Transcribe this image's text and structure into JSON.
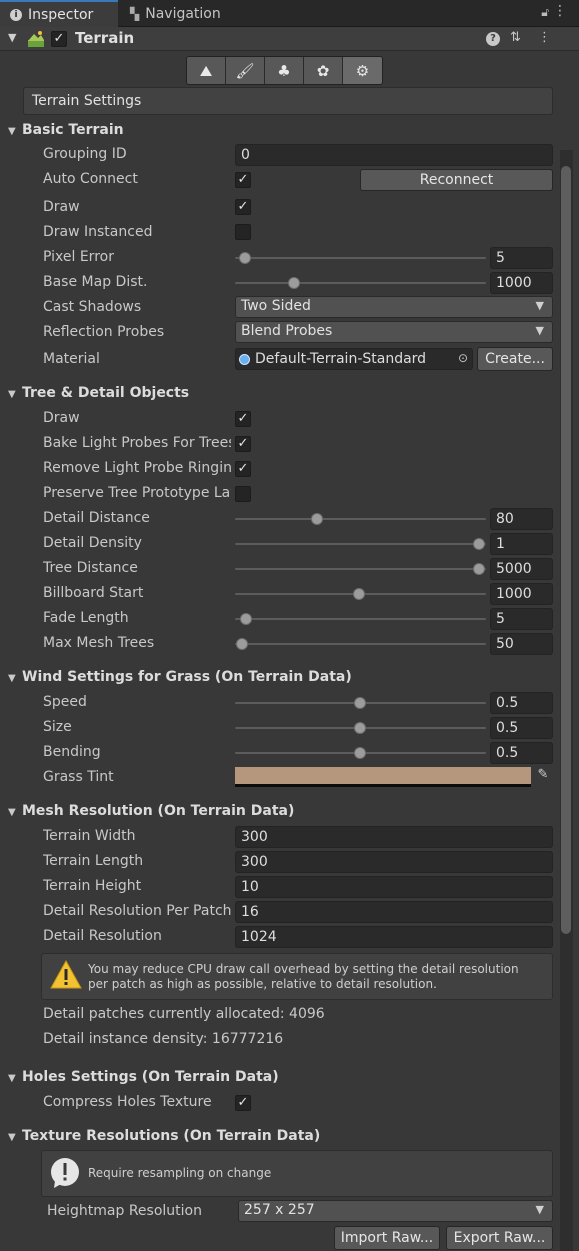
{
  "tabs": {
    "inspector": "Inspector",
    "navigation": "Navigation"
  },
  "component": {
    "name": "Terrain",
    "enabled": true
  },
  "settings_title": "Terrain Settings",
  "basic_terrain": {
    "header": "Basic Terrain",
    "grouping_id_label": "Grouping ID",
    "grouping_id": "0",
    "auto_connect_label": "Auto Connect",
    "auto_connect": true,
    "reconnect_button": "Reconnect",
    "draw_label": "Draw",
    "draw": true,
    "draw_instanced_label": "Draw Instanced",
    "draw_instanced": false,
    "pixel_error_label": "Pixel Error",
    "pixel_error": "5",
    "base_map_dist_label": "Base Map Dist.",
    "base_map_dist": "1000",
    "cast_shadows_label": "Cast Shadows",
    "cast_shadows": "Two Sided",
    "reflection_probes_label": "Reflection Probes",
    "reflection_probes": "Blend Probes",
    "material_label": "Material",
    "material": "Default-Terrain-Standard",
    "create_button": "Create..."
  },
  "tree_detail": {
    "header": "Tree & Detail Objects",
    "draw_label": "Draw",
    "draw": true,
    "bake_label": "Bake Light Probes For Trees",
    "bake": true,
    "remove_label": "Remove Light Probe Ringing",
    "remove": true,
    "preserve_label": "Preserve Tree Prototype Layers",
    "preserve": false,
    "detail_distance_label": "Detail Distance",
    "detail_distance": "80",
    "detail_density_label": "Detail Density",
    "detail_density": "1",
    "tree_distance_label": "Tree Distance",
    "tree_distance": "5000",
    "billboard_start_label": "Billboard Start",
    "billboard_start": "1000",
    "fade_length_label": "Fade Length",
    "fade_length": "5",
    "max_mesh_trees_label": "Max Mesh Trees",
    "max_mesh_trees": "50"
  },
  "wind": {
    "header": "Wind Settings for Grass (On Terrain Data)",
    "speed_label": "Speed",
    "speed": "0.5",
    "size_label": "Size",
    "size": "0.5",
    "bending_label": "Bending",
    "bending": "0.5",
    "grass_tint_label": "Grass Tint",
    "grass_tint_color": "#b5977e"
  },
  "mesh": {
    "header": "Mesh Resolution (On Terrain Data)",
    "width_label": "Terrain Width",
    "width": "300",
    "length_label": "Terrain Length",
    "length": "300",
    "height_label": "Terrain Height",
    "height": "10",
    "detail_per_patch_label": "Detail Resolution Per Patch",
    "detail_per_patch": "16",
    "detail_res_label": "Detail Resolution",
    "detail_res": "1024",
    "warning_line1": "You may reduce CPU draw call overhead by setting the detail resolution",
    "warning_line2": "per patch as high as possible, relative to detail resolution.",
    "patches_allocated": "Detail patches currently allocated: 4096",
    "instance_density": "Detail instance density: 16777216"
  },
  "holes": {
    "header": "Holes Settings (On Terrain Data)",
    "compress_label": "Compress Holes Texture",
    "compress": true
  },
  "texture": {
    "header": "Texture Resolutions (On Terrain Data)",
    "info": "Require resampling on change",
    "heightmap_label": "Heightmap Resolution",
    "heightmap": "257 x 257",
    "import_button": "Import Raw...",
    "export_button": "Export Raw..."
  },
  "colors": {
    "accent": "#3a79bb",
    "warning": "#f2c233"
  }
}
